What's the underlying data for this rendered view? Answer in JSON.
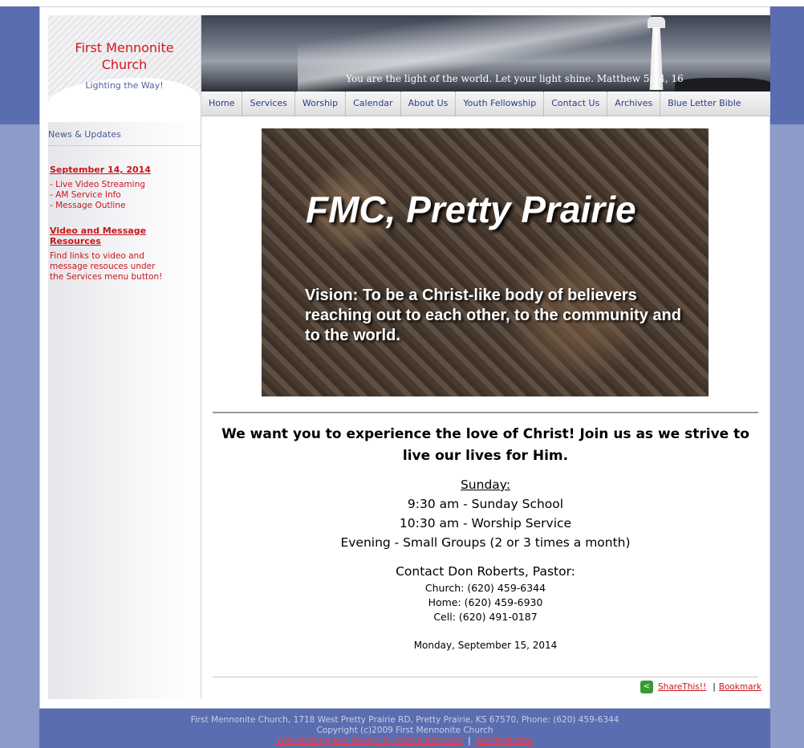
{
  "site": {
    "name_line1": "First Mennonite",
    "name_line2": "Church",
    "tagline": "Lighting the Way!"
  },
  "header": {
    "quote": "You are the light of the world. Let your light shine.    Matthew 5:14, 16"
  },
  "nav": {
    "items": [
      "Home",
      "Services",
      "Worship",
      "Calendar",
      "About Us",
      "Youth Fellowship",
      "Contact Us",
      "Archives",
      "Blue Letter Bible"
    ]
  },
  "sidebar": {
    "heading": "News & Updates",
    "date": "September 14, 2014",
    "links": [
      "- Live Video Streaming",
      "- AM Service Info",
      "- Message Outline"
    ],
    "video_title": "Video and Message Resources",
    "video_desc": "Find links to video and message resouces under the Services menu button!"
  },
  "hero": {
    "title": "FMC, Pretty Prairie",
    "vision": "Vision: To be a Christ-like body of believers reaching out to each other, to the community and to the world."
  },
  "main": {
    "welcome": "We want you to experience the love of Christ! Join us as we strive to live our lives for Him.",
    "sunday_label": "Sunday:",
    "services": [
      "9:30 am - Sunday School",
      "10:30 am - Worship Service",
      "Evening - Small Groups (2 or 3 times a month)"
    ],
    "contact_heading": "Contact Don Roberts, Pastor:",
    "phones": [
      "Church:  (620) 459-6344",
      "Home:  (620) 459-6930",
      "Cell:   (620) 491-0187"
    ],
    "date": "Monday, September 15, 2014"
  },
  "share": {
    "share_label": "ShareThis!!",
    "separator": "|",
    "bookmark_label": "Bookmark"
  },
  "footer": {
    "address": "First Mennonite Church, 1718 West Pretty Prairie RD, Pretty Prairie, KS 67570, Phone: (620) 459-6344",
    "copyright": "Copyright (c)2009 First Mennonite Church",
    "hosting_link": "Web Hosting and Design by OurChurch.Com",
    "separator": "|",
    "admin_link": "Administrator"
  },
  "colors": {
    "accent_red": "#c8161b",
    "nav_text": "#2a3a8a",
    "page_bg": "#5a6db0"
  }
}
